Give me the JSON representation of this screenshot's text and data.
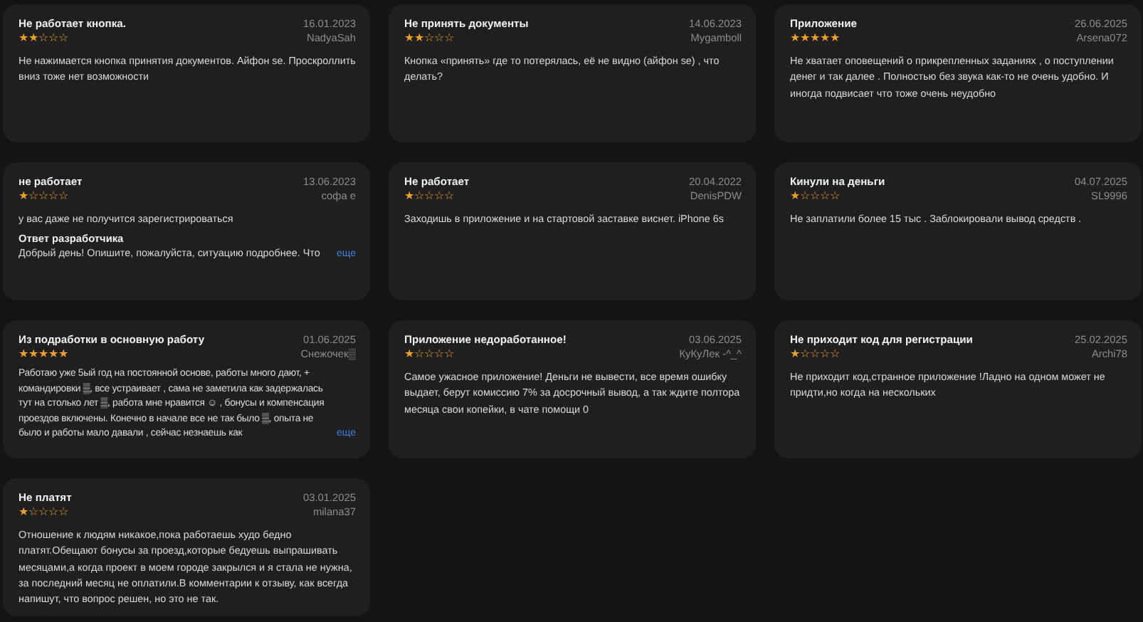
{
  "reviews": [
    {
      "title": "Не работает кнопка.",
      "stars": 2,
      "date": "16.01.2023",
      "author": "NadyaSah",
      "text": "Не нажимается кнопка принятия документов. Айфон se. Проскроллить вниз тоже нет возможности"
    },
    {
      "title": "Не принять документы",
      "stars": 2,
      "date": "14.06.2023",
      "author": "Mygamboll",
      "text": "Кнопка «принять» где то потерялась, её не видно (айфон se) , что делать?"
    },
    {
      "title": "Приложение",
      "stars": 5,
      "date": "26.06.2025",
      "author": "Arsena072",
      "text": "Не хватает оповещений о прикрепленных заданиях , о поступлении денег и так далее . Полностью без звука как-то не очень удобно. И иногда подвисает что тоже очень неудобно"
    },
    {
      "title": "не работает",
      "stars": 1,
      "date": "13.06.2023",
      "author": "софа е",
      "text": "у вас даже не получится зарегистрироваться",
      "reply": {
        "heading": "Ответ разработчика",
        "text": "Добрый день! Опишите, пожалуйста, ситуацию подробнее. Что",
        "more": "еще"
      }
    },
    {
      "title": "Не работает",
      "stars": 1,
      "date": "20.04.2022",
      "author": "DenisPDW",
      "text": "Заходишь в приложение и на стартовой заставке виснет. iPhone 6s"
    },
    {
      "title": "Кинули на деньги",
      "stars": 1,
      "date": "04.07.2025",
      "author": "SL9996",
      "text": "Не заплатили более 15 тыс . Заблокировали вывод средств ."
    },
    {
      "title": "Из подработки в основную работу",
      "stars": 5,
      "date": "01.06.2025",
      "author": "Снежочек▒",
      "text": "Работаю уже 5ый год на постоянной основе, работы много дают, + командировки ▒, все устраивает , сама не заметила как задержалась тут на столько лет ▒, работа мне нравится ☺ , бонусы и компенсация проездов включены. Конечно в начале все не так было ▒, опыта не было и работы мало давали , сейчас незнаешь как",
      "more": "еще"
    },
    {
      "title": "Приложение недоработанное!",
      "stars": 1,
      "date": "03.06.2025",
      "author": "КуКуЛек -^_^",
      "text": "Самое ужасное приложение! Деньги не вывести, все время ошибку выдает, берут комиссию 7% за досрочный вывод, а так ждите полтора месяца свои копейки, в чате помощи 0"
    },
    {
      "title": "Не приходит код для регистрации",
      "stars": 1,
      "date": "25.02.2025",
      "author": "Archi78",
      "text": "Не приходит код,странное приложение !Ладно на одном может не придти,но когда на нескольких"
    },
    {
      "title": "Не платят",
      "stars": 1,
      "date": "03.01.2025",
      "author": "milana37",
      "text": "Отношение  к людям никакое,пока работаешь худо бедно платят.Обещают бонусы за проезд,которые бедуешь выпрашивать месяцами,а когда проект в моем городе закрылся и я стала не нужна, за последний месяц не оплатили.В комментарии к отзыву, как всегда напишут, что вопрос решен, но это не так."
    }
  ]
}
